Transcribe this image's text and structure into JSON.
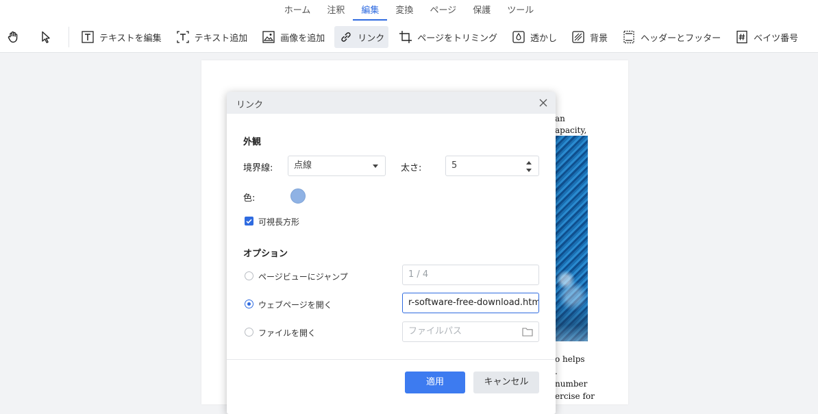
{
  "menu": {
    "items": [
      {
        "label": "ホーム",
        "active": false
      },
      {
        "label": "注釈",
        "active": false
      },
      {
        "label": "編集",
        "active": true
      },
      {
        "label": "変換",
        "active": false
      },
      {
        "label": "ページ",
        "active": false
      },
      {
        "label": "保護",
        "active": false
      },
      {
        "label": "ツール",
        "active": false
      }
    ]
  },
  "toolbar": {
    "hand_icon": "hand-icon",
    "select_icon": "cursor-icon",
    "edit_text_label": "テキストを編集",
    "add_text_label": "テキスト追加",
    "add_image_label": "画像を追加",
    "link_label": "リンク",
    "crop_label": "ページをトリミング",
    "watermark_label": "透かし",
    "background_label": "背景",
    "header_footer_label": "ヘッダーとフッター",
    "bates_label": "ベイツ番号"
  },
  "document": {
    "lines_top": [
      "an",
      "apacity,"
    ],
    "lines_bottom": [
      "o helps",
      ".",
      "number",
      "ercise for"
    ]
  },
  "dialog": {
    "title": "リンク",
    "appearance": {
      "section_title": "外観",
      "border_label": "境界線:",
      "border_value": "点線",
      "thickness_label": "太さ:",
      "thickness_value": "5",
      "color_label": "色:",
      "color_value": "#8fb2e4",
      "visible_rect_label": "可視長方形",
      "visible_rect_checked": true
    },
    "options": {
      "section_title": "オプション",
      "jump_label": "ページビューにジャンプ",
      "jump_value": "1 / 4",
      "open_web_label": "ウェブページを開く",
      "open_web_value": "r-software-free-download.html",
      "open_file_label": "ファイルを開く",
      "open_file_placeholder": "ファイルパス",
      "selected": "open_web"
    },
    "apply_label": "適用",
    "cancel_label": "キャンセル"
  },
  "colors": {
    "accent": "#2f6be0",
    "primary_button": "#3d7bf0"
  }
}
